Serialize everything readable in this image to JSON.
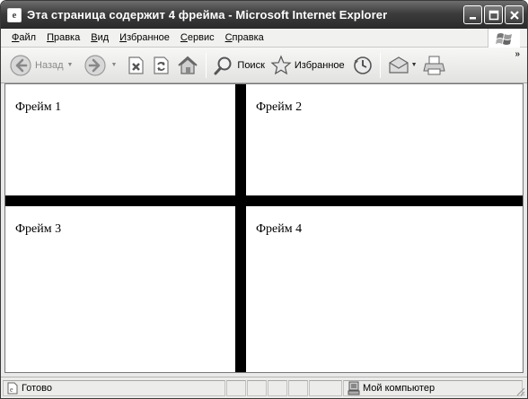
{
  "window": {
    "title": "Эта страница содержит 4 фрейма - Microsoft Internet Explorer",
    "icon": "ie-page-icon"
  },
  "menu": [
    {
      "label": "Файл",
      "mnemonic": "Ф"
    },
    {
      "label": "Правка",
      "mnemonic": "П"
    },
    {
      "label": "Вид",
      "mnemonic": "В"
    },
    {
      "label": "Избранное",
      "mnemonic": "И"
    },
    {
      "label": "Сервис",
      "mnemonic": "С"
    },
    {
      "label": "Справка",
      "mnemonic": "С"
    }
  ],
  "toolbar": {
    "back_label": "Назад",
    "search_label": "Поиск",
    "favorites_label": "Избранное"
  },
  "frames": [
    {
      "label": "Фрейм 1"
    },
    {
      "label": "Фрейм 2"
    },
    {
      "label": "Фрейм 3"
    },
    {
      "label": "Фрейм 4"
    }
  ],
  "status": {
    "text": "Готово",
    "zone": "Мой компьютер"
  }
}
